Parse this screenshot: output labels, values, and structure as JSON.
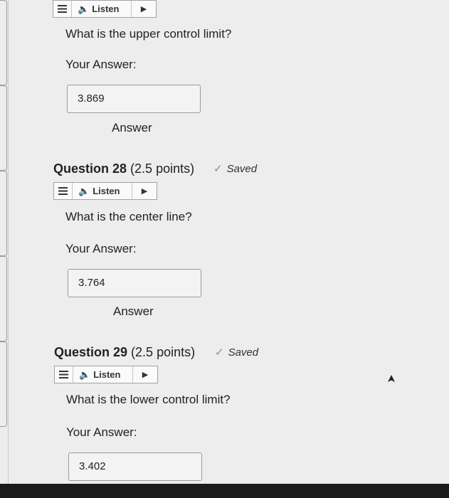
{
  "listen_label": "Listen",
  "play_glyph": "▶",
  "speaker_glyph": "🔈",
  "answer_label": "Your Answer:",
  "answer_button_label": "Answer",
  "saved_label": "Saved",
  "check_glyph": "✓",
  "questions": [
    {
      "text": "What is the upper control limit?",
      "value": "3.869"
    },
    {
      "number": "Question 28",
      "points": "(2.5 points)",
      "text": "What is the center line?",
      "value": "3.764"
    },
    {
      "number": "Question 29",
      "points": "(2.5 points)",
      "text": "What is the lower control limit?",
      "value": "3.402"
    }
  ],
  "colors": {
    "background": "#ededed",
    "text": "#222222",
    "border": "#9a9a9a"
  },
  "icons": [
    "menu-icon",
    "speaker-icon",
    "play-icon",
    "check-icon",
    "cursor-icon"
  ]
}
